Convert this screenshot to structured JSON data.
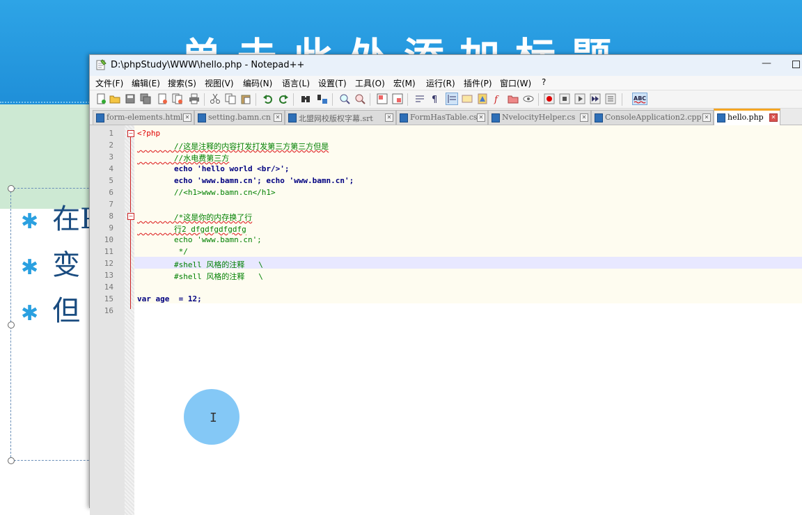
{
  "slide": {
    "title": "单击此处添加标题",
    "bullets": [
      "在P",
      "变",
      "但"
    ],
    "colors": {
      "header": "#1f8fd8",
      "accent_green": "#cde9d3",
      "bullet_text": "#1a4c80"
    }
  },
  "window": {
    "title": "D:\\phpStudy\\WWW\\hello.php - Notepad++",
    "icon": "notepad-icon"
  },
  "menu": [
    "文件(F)",
    "编辑(E)",
    "搜索(S)",
    "视图(V)",
    "编码(N)",
    "语言(L)",
    "设置(T)",
    "工具(O)",
    "宏(M)",
    "运行(R)",
    "插件(P)",
    "窗口(W)",
    "?"
  ],
  "toolbar_icons": [
    "new-file-icon",
    "open-file-icon",
    "save-icon",
    "save-all-icon",
    "close-icon",
    "close-all-icon",
    "print-icon",
    "cut-icon",
    "copy-icon",
    "paste-icon",
    "undo-icon",
    "redo-icon",
    "find-icon",
    "replace-icon",
    "zoom-in-icon",
    "zoom-out-icon",
    "sync-v-icon",
    "sync-h-icon",
    "wrap-icon",
    "show-all-chars-icon",
    "indent-guide-icon",
    "udl-icon",
    "doc-map-icon",
    "function-list-icon",
    "folder-as-workspace-icon",
    "monitor-icon",
    "record-macro-icon",
    "stop-record-icon",
    "play-macro-icon",
    "run-macro-multiple-icon",
    "save-macro-icon",
    "spellcheck-icon"
  ],
  "tabs": [
    {
      "label": "form-elements.html",
      "active": false
    },
    {
      "label": "setting.bamn.cn",
      "active": false
    },
    {
      "label": "北盟网校版权字幕.srt",
      "active": false
    },
    {
      "label": "FormHasTable.cs",
      "active": false
    },
    {
      "label": "NvelocityHelper.cs",
      "active": false
    },
    {
      "label": "ConsoleApplication2.cpp",
      "active": false
    },
    {
      "label": "hello.php",
      "active": true
    }
  ],
  "editor": {
    "line_numbers": [
      "1",
      "2",
      "3",
      "4",
      "5",
      "6",
      "7",
      "8",
      "9",
      "10",
      "11",
      "12",
      "13",
      "14",
      "15",
      "16"
    ],
    "current_line": 12,
    "lines": [
      "<?php",
      "        //这是注释的内容打发打发第三方第三方但是",
      "        //水电费第三方",
      "        echo 'hello world <br/>';",
      "        echo 'www.bamn.cn'; echo 'www.bamn.cn';",
      "        //<h1>www.bamn.cn</h1>",
      "",
      "        /*这是你的内存换了行",
      "        行2 dfgdfgdfgdfg",
      "        echo 'www.bamn.cn';",
      "         */",
      "        #shell 风格的注释   \\",
      "        #shell 风格的注释   \\",
      "",
      "var age  = 12;",
      ""
    ]
  }
}
